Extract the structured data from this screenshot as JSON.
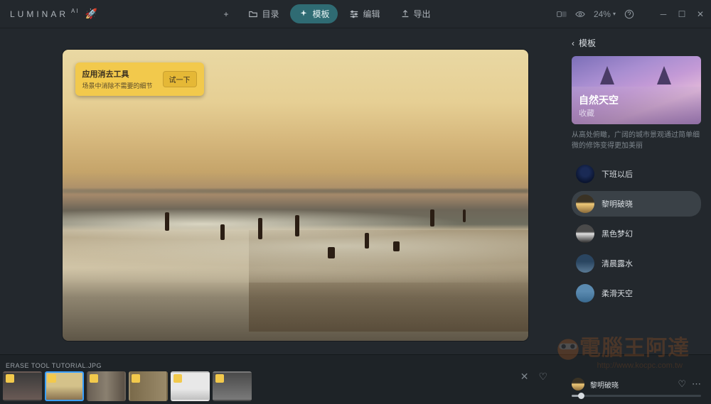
{
  "brand": {
    "name": "LUMINAR",
    "suffix": "AI"
  },
  "topnav": {
    "add": "+",
    "items": [
      {
        "label": "目录"
      },
      {
        "label": "模板"
      },
      {
        "label": "编辑"
      },
      {
        "label": "导出"
      }
    ],
    "zoom": "24%"
  },
  "tip": {
    "title": "应用消去工具",
    "subtitle": "场景中消除不需要的细节",
    "try": "试一下"
  },
  "panel": {
    "back": "模板",
    "hero_title": "自然天空",
    "hero_sub": "收藏",
    "desc": "从高处俯瞰，广阔的城市景观通过简单细微的修饰变得更加美丽",
    "presets": [
      {
        "label": "下班以后"
      },
      {
        "label": "黎明破晓"
      },
      {
        "label": "黑色梦幻"
      },
      {
        "label": "清晨露水"
      },
      {
        "label": "柔滑天空"
      }
    ]
  },
  "filmstrip": {
    "filename": "ERASE TOOL TUTORIAL.JPG",
    "applied_label": "黎明破晓"
  },
  "watermark": {
    "main": "電腦王阿達",
    "url": "http://www.kocpc.com.tw"
  }
}
